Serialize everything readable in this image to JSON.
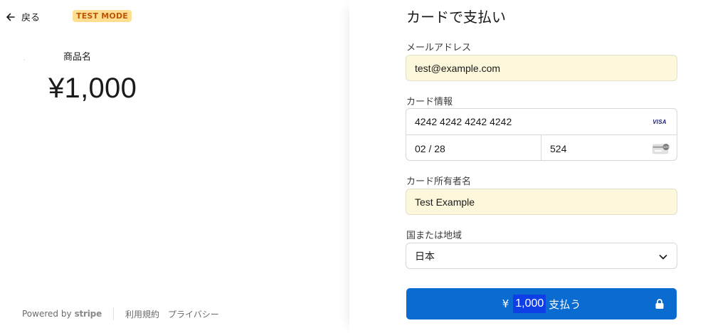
{
  "header": {
    "back_label": "戻る",
    "test_badge": "TEST MODE"
  },
  "product": {
    "name": "商品名",
    "price": "¥1,000"
  },
  "footer": {
    "powered_by": "Powered by",
    "brand": "stripe",
    "terms": "利用規約",
    "privacy": "プライバシー"
  },
  "payment": {
    "heading": "カードで支払い",
    "email_label": "メールアドレス",
    "email_value": "test@example.com",
    "card_label": "カード情報",
    "card_number": "4242 4242 4242 4242",
    "card_brand": "VISA",
    "expiry": "02 / 28",
    "cvc": "524",
    "holder_label": "カード所有者名",
    "holder_value": "Test Example",
    "country_label": "国または地域",
    "country_value": "日本",
    "button_currency": "¥",
    "button_amount": "1,000",
    "button_label": "支払う"
  },
  "colors": {
    "accent": "#0a6bd1",
    "test_badge_bg": "#ffde92",
    "test_badge_text": "#bb5504",
    "autofill_bg": "#fdf8dc"
  }
}
